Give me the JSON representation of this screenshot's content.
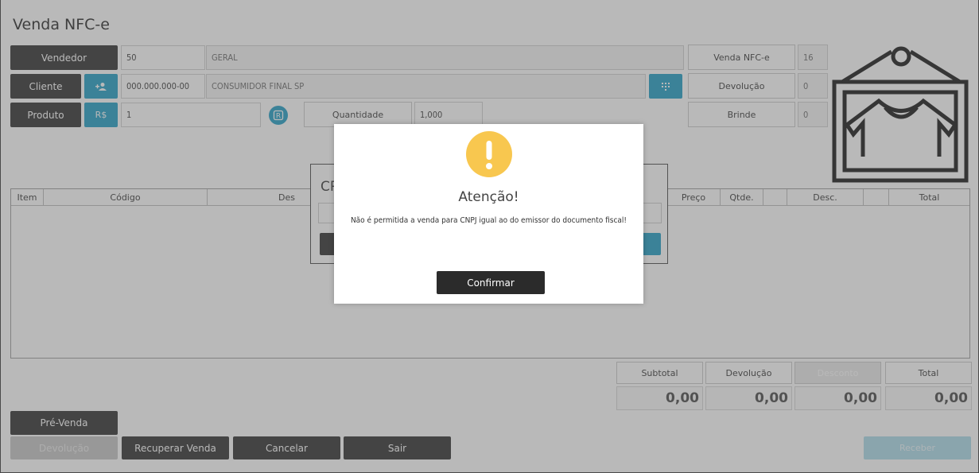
{
  "title": "Venda NFC-e",
  "vendedor": {
    "label": "Vendedor",
    "code": "50",
    "name": "GERAL"
  },
  "cliente": {
    "label": "Cliente",
    "doc": "000.000.000-00",
    "name": "CONSUMIDOR FINAL SP"
  },
  "produto": {
    "label": "Produto",
    "price_btn": "R$",
    "code": "1",
    "quantidade_label": "Quantidade",
    "quantidade": "1,000"
  },
  "right_panel": [
    {
      "label": "Venda NFC-e",
      "value": "16"
    },
    {
      "label": "Devolução",
      "value": "0"
    },
    {
      "label": "Brinde",
      "value": "0"
    }
  ],
  "grid": {
    "columns": [
      "Item",
      "Código",
      "Des",
      "Preço",
      "Qtde.",
      "",
      "Desc.",
      "",
      "Total"
    ]
  },
  "totals": {
    "labels": [
      "Subtotal",
      "Devolução",
      "Desconto",
      "Total"
    ],
    "values": [
      "0,00",
      "0,00",
      "0,00",
      "0,00"
    ]
  },
  "bottom": {
    "pre_venda": "Pré-Venda",
    "devolucao": "Devolução",
    "recuperar": "Recuperar Venda",
    "cancelar": "Cancelar",
    "sair": "Sair",
    "receber": "Receber"
  },
  "background_dialog": {
    "title_fragment": "CP"
  },
  "modal": {
    "title": "Atenção!",
    "message": "Não é permitida a venda para CNPJ igual ao do emissor do documento fiscal!",
    "confirm": "Confirmar",
    "icon_color": "#f8c74f"
  },
  "colors": {
    "accent": "#1b9bc3",
    "dark_button": "#2b2b2b",
    "warning": "#f8c74f"
  }
}
